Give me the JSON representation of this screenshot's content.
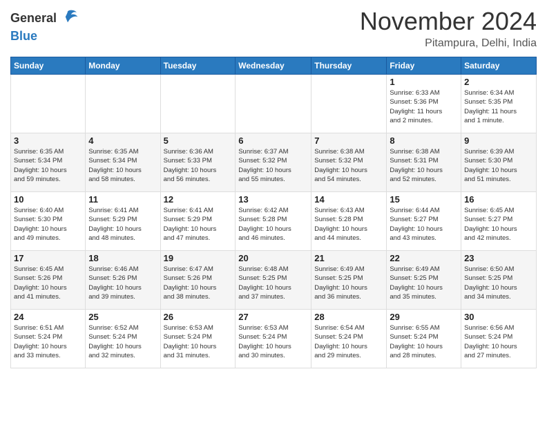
{
  "header": {
    "logo_general": "General",
    "logo_blue": "Blue",
    "month_title": "November 2024",
    "location": "Pitampura, Delhi, India"
  },
  "days_of_week": [
    "Sunday",
    "Monday",
    "Tuesday",
    "Wednesday",
    "Thursday",
    "Friday",
    "Saturday"
  ],
  "weeks": [
    [
      {
        "day": "",
        "info": ""
      },
      {
        "day": "",
        "info": ""
      },
      {
        "day": "",
        "info": ""
      },
      {
        "day": "",
        "info": ""
      },
      {
        "day": "",
        "info": ""
      },
      {
        "day": "1",
        "info": "Sunrise: 6:33 AM\nSunset: 5:36 PM\nDaylight: 11 hours\nand 2 minutes."
      },
      {
        "day": "2",
        "info": "Sunrise: 6:34 AM\nSunset: 5:35 PM\nDaylight: 11 hours\nand 1 minute."
      }
    ],
    [
      {
        "day": "3",
        "info": "Sunrise: 6:35 AM\nSunset: 5:34 PM\nDaylight: 10 hours\nand 59 minutes."
      },
      {
        "day": "4",
        "info": "Sunrise: 6:35 AM\nSunset: 5:34 PM\nDaylight: 10 hours\nand 58 minutes."
      },
      {
        "day": "5",
        "info": "Sunrise: 6:36 AM\nSunset: 5:33 PM\nDaylight: 10 hours\nand 56 minutes."
      },
      {
        "day": "6",
        "info": "Sunrise: 6:37 AM\nSunset: 5:32 PM\nDaylight: 10 hours\nand 55 minutes."
      },
      {
        "day": "7",
        "info": "Sunrise: 6:38 AM\nSunset: 5:32 PM\nDaylight: 10 hours\nand 54 minutes."
      },
      {
        "day": "8",
        "info": "Sunrise: 6:38 AM\nSunset: 5:31 PM\nDaylight: 10 hours\nand 52 minutes."
      },
      {
        "day": "9",
        "info": "Sunrise: 6:39 AM\nSunset: 5:30 PM\nDaylight: 10 hours\nand 51 minutes."
      }
    ],
    [
      {
        "day": "10",
        "info": "Sunrise: 6:40 AM\nSunset: 5:30 PM\nDaylight: 10 hours\nand 49 minutes."
      },
      {
        "day": "11",
        "info": "Sunrise: 6:41 AM\nSunset: 5:29 PM\nDaylight: 10 hours\nand 48 minutes."
      },
      {
        "day": "12",
        "info": "Sunrise: 6:41 AM\nSunset: 5:29 PM\nDaylight: 10 hours\nand 47 minutes."
      },
      {
        "day": "13",
        "info": "Sunrise: 6:42 AM\nSunset: 5:28 PM\nDaylight: 10 hours\nand 46 minutes."
      },
      {
        "day": "14",
        "info": "Sunrise: 6:43 AM\nSunset: 5:28 PM\nDaylight: 10 hours\nand 44 minutes."
      },
      {
        "day": "15",
        "info": "Sunrise: 6:44 AM\nSunset: 5:27 PM\nDaylight: 10 hours\nand 43 minutes."
      },
      {
        "day": "16",
        "info": "Sunrise: 6:45 AM\nSunset: 5:27 PM\nDaylight: 10 hours\nand 42 minutes."
      }
    ],
    [
      {
        "day": "17",
        "info": "Sunrise: 6:45 AM\nSunset: 5:26 PM\nDaylight: 10 hours\nand 41 minutes."
      },
      {
        "day": "18",
        "info": "Sunrise: 6:46 AM\nSunset: 5:26 PM\nDaylight: 10 hours\nand 39 minutes."
      },
      {
        "day": "19",
        "info": "Sunrise: 6:47 AM\nSunset: 5:26 PM\nDaylight: 10 hours\nand 38 minutes."
      },
      {
        "day": "20",
        "info": "Sunrise: 6:48 AM\nSunset: 5:25 PM\nDaylight: 10 hours\nand 37 minutes."
      },
      {
        "day": "21",
        "info": "Sunrise: 6:49 AM\nSunset: 5:25 PM\nDaylight: 10 hours\nand 36 minutes."
      },
      {
        "day": "22",
        "info": "Sunrise: 6:49 AM\nSunset: 5:25 PM\nDaylight: 10 hours\nand 35 minutes."
      },
      {
        "day": "23",
        "info": "Sunrise: 6:50 AM\nSunset: 5:25 PM\nDaylight: 10 hours\nand 34 minutes."
      }
    ],
    [
      {
        "day": "24",
        "info": "Sunrise: 6:51 AM\nSunset: 5:24 PM\nDaylight: 10 hours\nand 33 minutes."
      },
      {
        "day": "25",
        "info": "Sunrise: 6:52 AM\nSunset: 5:24 PM\nDaylight: 10 hours\nand 32 minutes."
      },
      {
        "day": "26",
        "info": "Sunrise: 6:53 AM\nSunset: 5:24 PM\nDaylight: 10 hours\nand 31 minutes."
      },
      {
        "day": "27",
        "info": "Sunrise: 6:53 AM\nSunset: 5:24 PM\nDaylight: 10 hours\nand 30 minutes."
      },
      {
        "day": "28",
        "info": "Sunrise: 6:54 AM\nSunset: 5:24 PM\nDaylight: 10 hours\nand 29 minutes."
      },
      {
        "day": "29",
        "info": "Sunrise: 6:55 AM\nSunset: 5:24 PM\nDaylight: 10 hours\nand 28 minutes."
      },
      {
        "day": "30",
        "info": "Sunrise: 6:56 AM\nSunset: 5:24 PM\nDaylight: 10 hours\nand 27 minutes."
      }
    ]
  ]
}
